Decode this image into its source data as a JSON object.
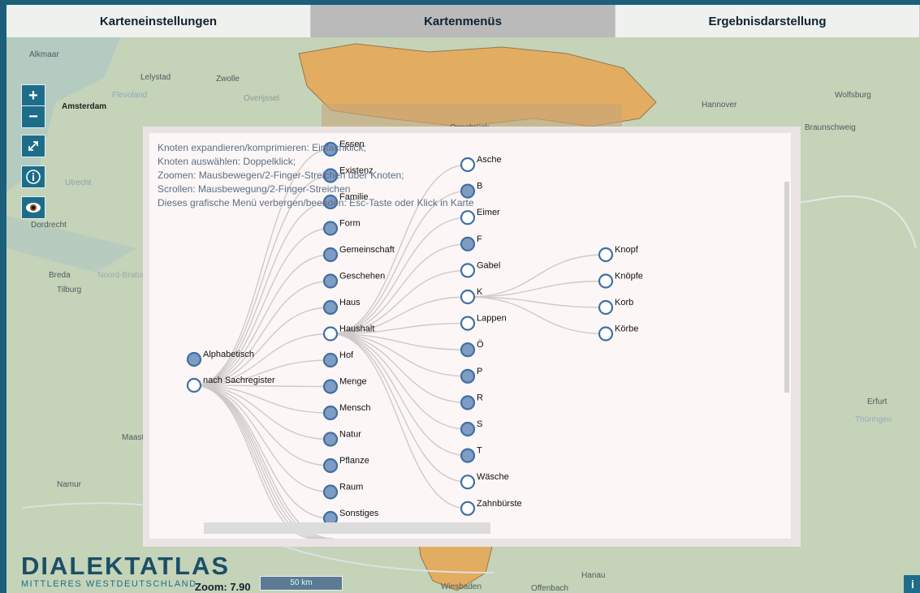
{
  "tabs": [
    {
      "label": "Karteneinstellungen",
      "active": false
    },
    {
      "label": "Kartenmenüs",
      "active": true
    },
    {
      "label": "Ergebnisdarstellung",
      "active": false
    }
  ],
  "controls": {
    "zoom_in_label": "+",
    "zoom_out_label": "−",
    "fullscreen_icon": "expand-arrows-icon",
    "info_icon": "info-circle-icon",
    "visibility_icon": "eye-icon"
  },
  "help_lines": [
    "Knoten expandieren/komprimieren: Einfachklick;",
    "Knoten auswählen: Doppelklick;",
    "Zoomen: Mausbewegen/2-Finger-Streichen über Knoten;",
    "Scrollen: Mausbewegung/2-Finger-Streichen",
    "Dieses grafische Menü verbergen/beenden: Esc-Taste oder Klick in Karte"
  ],
  "tree": {
    "level1": [
      {
        "label": "Alphabetisch",
        "filled": true
      },
      {
        "label": "nach Sachregister",
        "filled": false
      }
    ],
    "level2": [
      {
        "label": "Essen",
        "filled": true
      },
      {
        "label": "Existenz",
        "filled": true
      },
      {
        "label": "Familie",
        "filled": true
      },
      {
        "label": "Form",
        "filled": true
      },
      {
        "label": "Gemeinschaft",
        "filled": true
      },
      {
        "label": "Geschehen",
        "filled": true
      },
      {
        "label": "Haus",
        "filled": true
      },
      {
        "label": "Haushalt",
        "filled": false
      },
      {
        "label": "Hof",
        "filled": true
      },
      {
        "label": "Menge",
        "filled": true
      },
      {
        "label": "Mensch",
        "filled": true
      },
      {
        "label": "Natur",
        "filled": true
      },
      {
        "label": "Pflanze",
        "filled": true
      },
      {
        "label": "Raum",
        "filled": true
      },
      {
        "label": "Sonstiges",
        "filled": true
      }
    ],
    "level3": [
      {
        "label": "Asche",
        "filled": false
      },
      {
        "label": "B",
        "filled": true
      },
      {
        "label": "Eimer",
        "filled": false
      },
      {
        "label": "F",
        "filled": true
      },
      {
        "label": "Gabel",
        "filled": false
      },
      {
        "label": "K",
        "filled": false
      },
      {
        "label": "Lappen",
        "filled": false
      },
      {
        "label": "Ö",
        "filled": true
      },
      {
        "label": "P",
        "filled": true
      },
      {
        "label": "R",
        "filled": true
      },
      {
        "label": "S",
        "filled": true
      },
      {
        "label": "T",
        "filled": true
      },
      {
        "label": "Wäsche",
        "filled": false
      },
      {
        "label": "Zahnbürste",
        "filled": false
      }
    ],
    "level4": [
      {
        "label": "Knopf",
        "filled": false
      },
      {
        "label": "Knöpfe",
        "filled": false
      },
      {
        "label": "Korb",
        "filled": false
      },
      {
        "label": "Körbe",
        "filled": false
      }
    ]
  },
  "places": [
    "Alkmaar",
    "Lelystad",
    "Zwolle",
    "Amsterdam",
    "Flevoland",
    "Overijssel",
    "Utrecht",
    "Dordrecht",
    "Breda",
    "Tilburg",
    "Noord-Brabant",
    "Maastricht",
    "Namur",
    "Hannover",
    "Wolfsburg",
    "Braunschweig",
    "Erfurt",
    "Thüringen",
    "Wiesbaden",
    "Offenbach",
    "Hanau",
    "Osnabrück"
  ],
  "logo": {
    "title": "DIALEKTATLAS",
    "subtitle": "MITTLERES WESTDEUTSCHLAND"
  },
  "zoom": {
    "label": "Zoom: 7.90"
  },
  "scale": {
    "label": "50 km"
  },
  "info_button": {
    "label": "i"
  }
}
